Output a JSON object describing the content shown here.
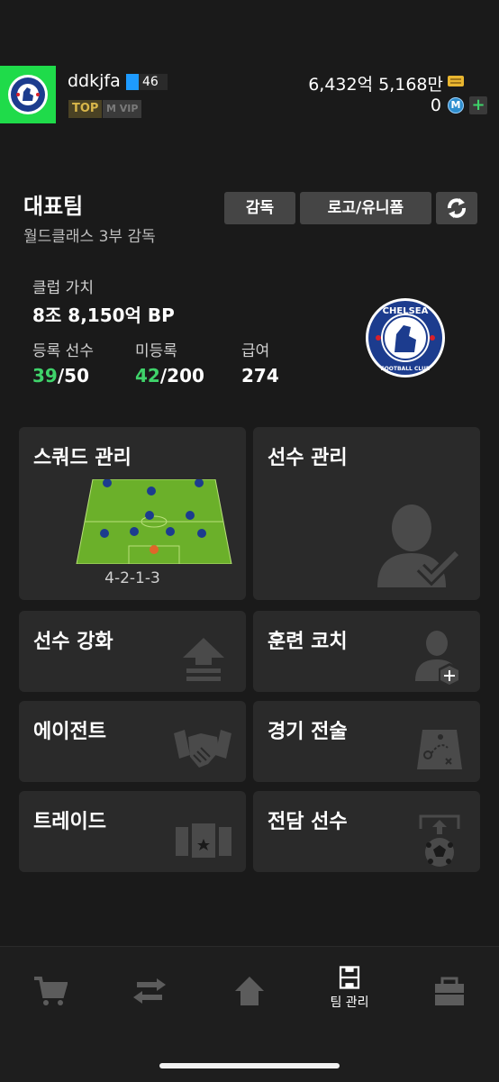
{
  "header": {
    "nickname": "ddkjfa",
    "level": "46",
    "tag_top": "TOP",
    "tag_vip": "M VIP",
    "bp_amount": "6,432억 5,168만",
    "coin_amount": "0",
    "coin_symbol": "M",
    "add_label": "+"
  },
  "team": {
    "title": "대표팀",
    "subtitle": "월드클래스 3부 감독",
    "coach_button": "감독",
    "logo_button": "로고/유니폼",
    "club_value_label": "클럽 가치",
    "club_value": "8조 8,150억 BP",
    "registered_label": "등록 선수",
    "registered_current": "39",
    "registered_max": "/50",
    "unregistered_label": "미등록",
    "unregistered_current": "42",
    "unregistered_max": "/200",
    "salary_label": "급여",
    "salary_value": "274",
    "club_name": "CHELSEA",
    "club_sub": "FOOTBALL CLUB"
  },
  "tiles": {
    "squad": "스쿼드 관리",
    "formation": "4-2-1-3",
    "players": "선수 관리",
    "upgrade": "선수 강화",
    "training": "훈련 코치",
    "agent": "에이전트",
    "tactics": "경기 전술",
    "trade": "트레이드",
    "dedicated": "전담 선수"
  },
  "nav": {
    "team_label": "팀 관리"
  },
  "colors": {
    "accent_green": "#3fd36a",
    "badge_green": "#1fdb4a",
    "chelsea_blue": "#1c3c8e",
    "level_blue": "#1e9bff"
  },
  "icons": [
    "chelsea-crest-icon",
    "bp-coin-icon",
    "m-coin-icon",
    "refresh-icon",
    "player-silhouette-icon",
    "upgrade-arrow-icon",
    "coach-plus-icon",
    "handshake-icon",
    "tactics-board-icon",
    "trade-cards-icon",
    "dedicated-ball-icon",
    "cart-icon",
    "transfer-icon",
    "home-icon",
    "team-pitch-icon",
    "locker-icon"
  ]
}
